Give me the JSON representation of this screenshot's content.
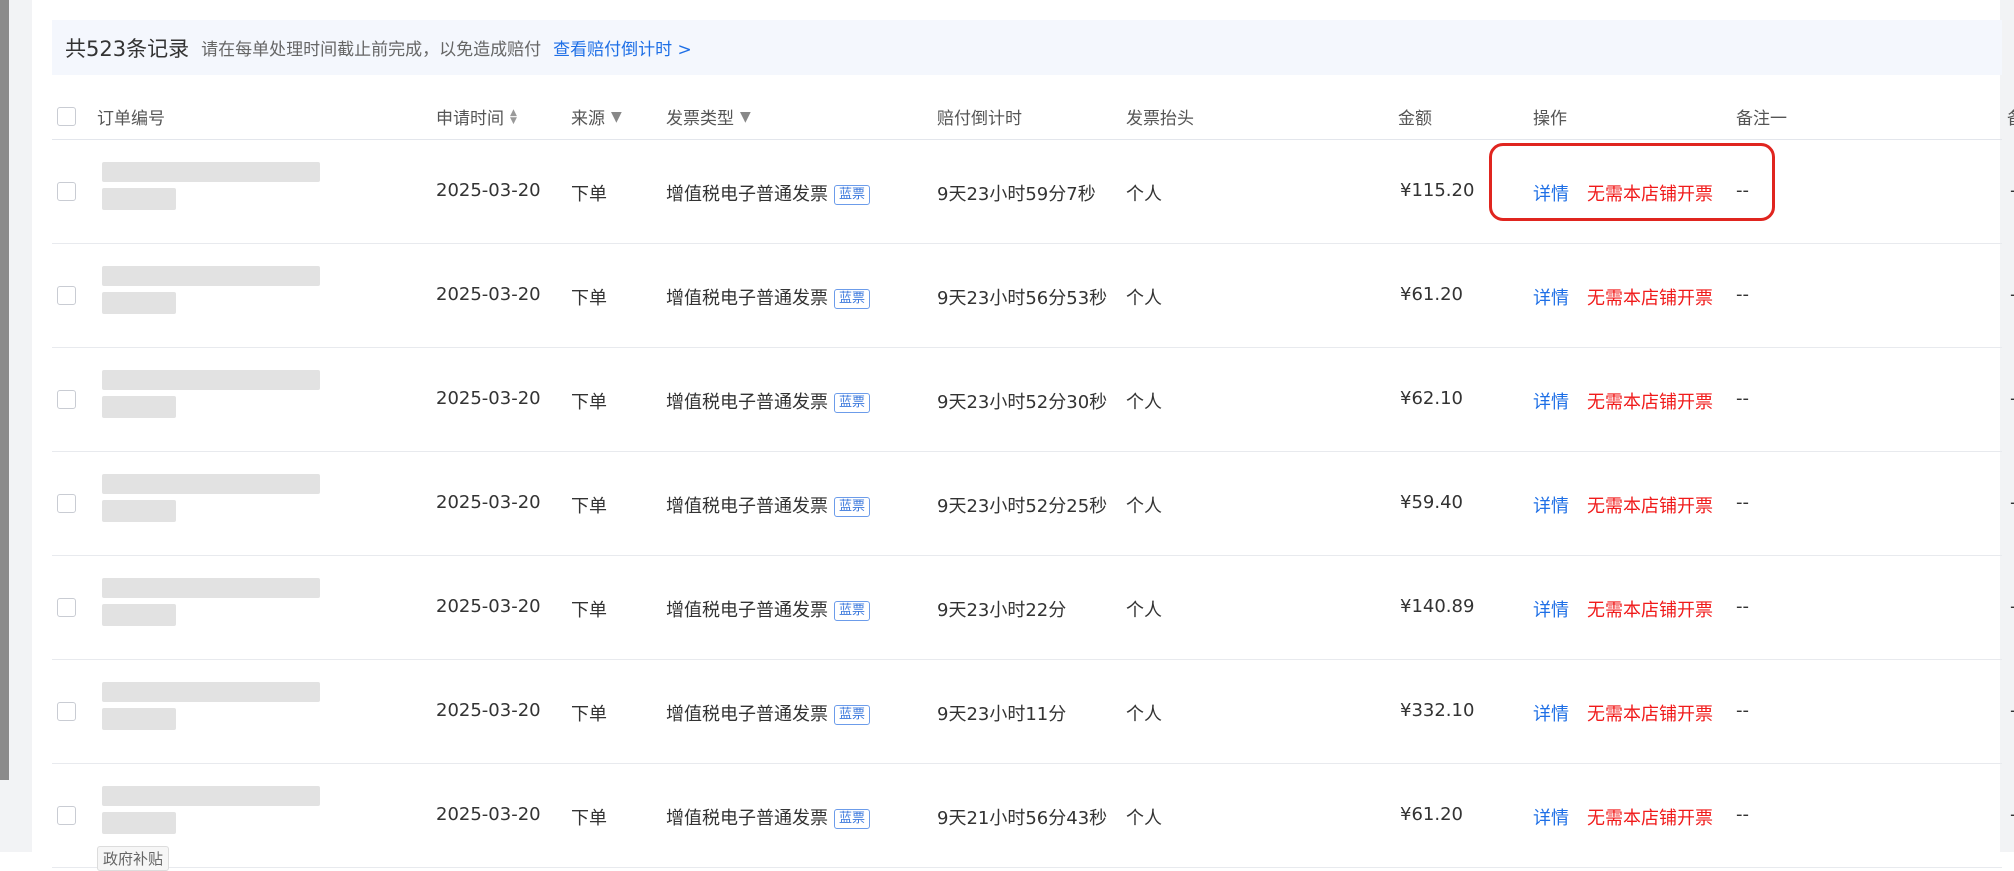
{
  "summary": {
    "count_text": "共523条记录",
    "hint": "请在每单处理时间截止前完成，以免造成赔付",
    "link": "查看赔付倒计时 >"
  },
  "columns": {
    "order_no": "订单编号",
    "apply_time": "申请时间",
    "source": "来源",
    "invoice_type": "发票类型",
    "countdown": "赔付倒计时",
    "invoice_title": "发票抬头",
    "amount": "金额",
    "action": "操作",
    "remark": "备注一",
    "extra": "备"
  },
  "icons": {
    "sort": "sort-icon",
    "filter": "filter-icon"
  },
  "colors": {
    "link": "#1e6fe6",
    "danger": "#f01b1b",
    "highlight": "#e0251f",
    "tag_border": "#6c9cea"
  },
  "rows": [
    {
      "date": "2025-03-20",
      "source": "下单",
      "invoice_type": "增值税电子普通发票",
      "tag": "蓝票",
      "countdown": "9天23小时59分7秒",
      "title": "个人",
      "amount": "¥115.20",
      "detail": "详情",
      "action2": "无需本店铺开票",
      "remark": "--",
      "extra": "-",
      "badge": ""
    },
    {
      "date": "2025-03-20",
      "source": "下单",
      "invoice_type": "增值税电子普通发票",
      "tag": "蓝票",
      "countdown": "9天23小时56分53秒",
      "title": "个人",
      "amount": "¥61.20",
      "detail": "详情",
      "action2": "无需本店铺开票",
      "remark": "--",
      "extra": "-",
      "badge": ""
    },
    {
      "date": "2025-03-20",
      "source": "下单",
      "invoice_type": "增值税电子普通发票",
      "tag": "蓝票",
      "countdown": "9天23小时52分30秒",
      "title": "个人",
      "amount": "¥62.10",
      "detail": "详情",
      "action2": "无需本店铺开票",
      "remark": "--",
      "extra": "-",
      "badge": ""
    },
    {
      "date": "2025-03-20",
      "source": "下单",
      "invoice_type": "增值税电子普通发票",
      "tag": "蓝票",
      "countdown": "9天23小时52分25秒",
      "title": "个人",
      "amount": "¥59.40",
      "detail": "详情",
      "action2": "无需本店铺开票",
      "remark": "--",
      "extra": "-",
      "badge": ""
    },
    {
      "date": "2025-03-20",
      "source": "下单",
      "invoice_type": "增值税电子普通发票",
      "tag": "蓝票",
      "countdown": "9天23小时22分",
      "title": "个人",
      "amount": "¥140.89",
      "detail": "详情",
      "action2": "无需本店铺开票",
      "remark": "--",
      "extra": "-",
      "badge": ""
    },
    {
      "date": "2025-03-20",
      "source": "下单",
      "invoice_type": "增值税电子普通发票",
      "tag": "蓝票",
      "countdown": "9天23小时11分",
      "title": "个人",
      "amount": "¥332.10",
      "detail": "详情",
      "action2": "无需本店铺开票",
      "remark": "--",
      "extra": "-",
      "badge": ""
    },
    {
      "date": "2025-03-20",
      "source": "下单",
      "invoice_type": "增值税电子普通发票",
      "tag": "蓝票",
      "countdown": "9天21小时56分43秒",
      "title": "个人",
      "amount": "¥61.20",
      "detail": "详情",
      "action2": "无需本店铺开票",
      "remark": "--",
      "extra": "-",
      "badge": "政府补贴"
    }
  ]
}
